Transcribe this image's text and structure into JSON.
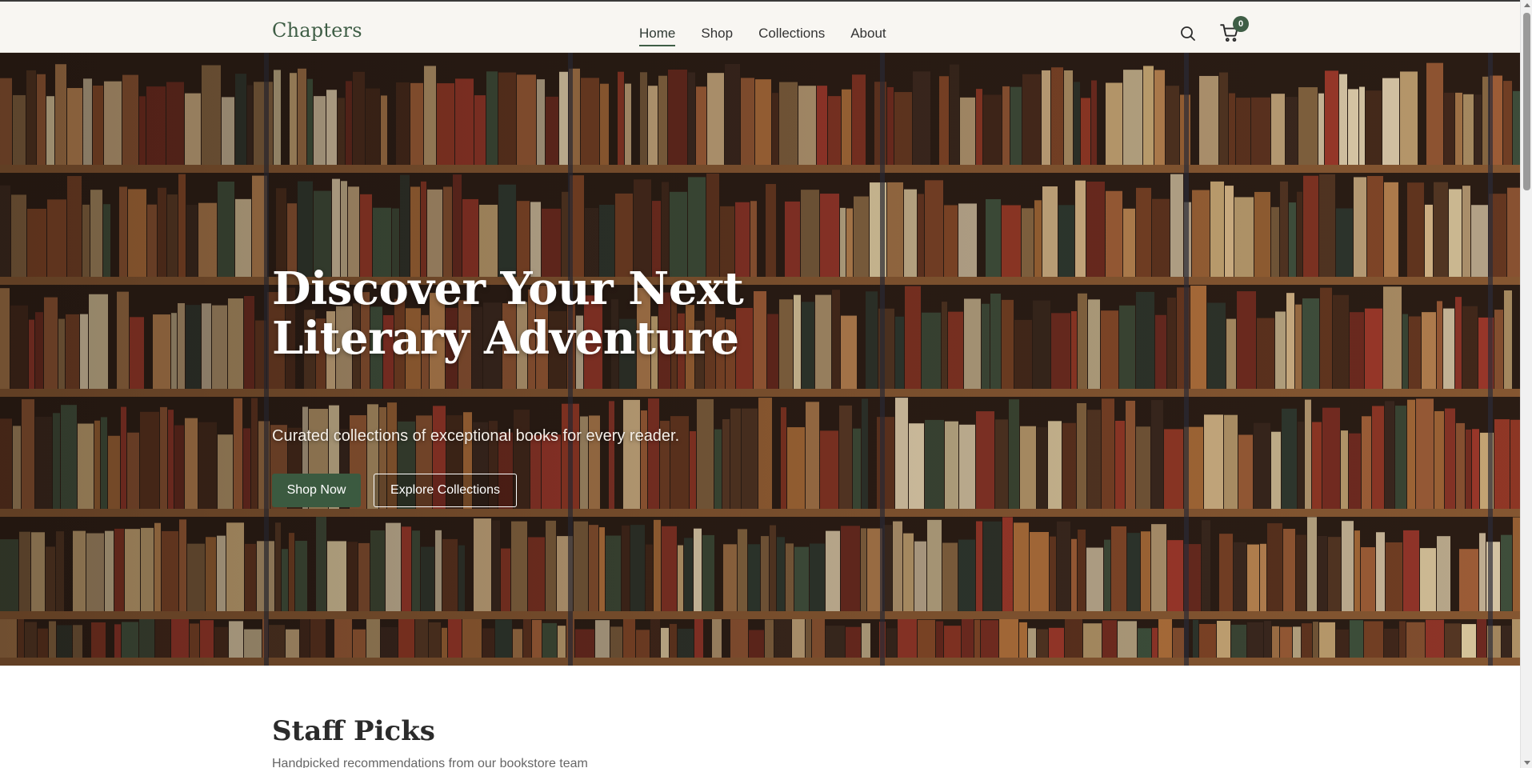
{
  "header": {
    "logo": "Chapters",
    "nav": [
      {
        "label": "Home",
        "active": true
      },
      {
        "label": "Shop",
        "active": false
      },
      {
        "label": "Collections",
        "active": false
      },
      {
        "label": "About",
        "active": false
      }
    ],
    "icons": {
      "search": "search-icon",
      "cart": "cart-icon"
    },
    "cart_count": "0"
  },
  "hero": {
    "title_line1": "Discover Your Next",
    "title_line2": "Literary Adventure",
    "subtitle": "Curated collections of exceptional books for every reader.",
    "primary_button": "Shop Now",
    "secondary_button": "Explore Collections"
  },
  "section": {
    "title": "Staff Picks",
    "subtitle": "Handpicked recommendations from our bookstore team"
  },
  "colors": {
    "brand": "#3f5e46",
    "header_bg": "#f8f6f2",
    "button_primary": "#3b5a40"
  }
}
